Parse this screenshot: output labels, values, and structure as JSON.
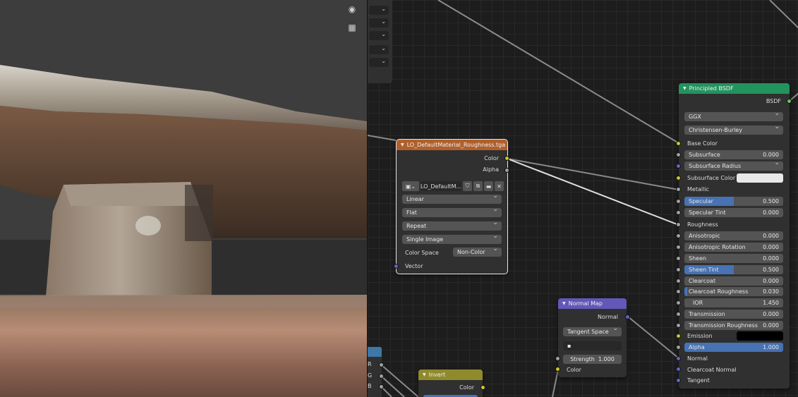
{
  "viewport": {
    "camera_icon": "camera-icon",
    "grid_icon": "grid-perspective-icon"
  },
  "texture_node": {
    "title": "LO_DefaultMaterial_Roughness.tga",
    "outputs": [
      "Color",
      "Alpha"
    ],
    "image_name": "LO_DefaultM...",
    "interpolation": "Linear",
    "projection": "Flat",
    "extension": "Repeat",
    "source": "Single Image",
    "color_space_label": "Color Space",
    "color_space_value": "Non-Color",
    "input_vector": "Vector",
    "header_color": "#b0602c"
  },
  "normal_map_node": {
    "title": "Normal Map",
    "output": "Normal",
    "space": "Tangent Space",
    "uv_map": "",
    "strength_label": "Strength",
    "strength_value": "1.000",
    "input_color": "Color",
    "header_color": "#6357b7"
  },
  "invert_node": {
    "title": "Invert",
    "output": "Color",
    "header_color": "#8f8a2b"
  },
  "partial_node": {
    "labels": [
      "R",
      "G",
      "B"
    ]
  },
  "bsdf_node": {
    "title": "Principled BSDF",
    "output": "BSDF",
    "distribution": "GGX",
    "subsurface_method": "Christensen-Burley",
    "header_color": "#23935d",
    "base_color_label": "Base Color",
    "subsurface": {
      "label": "Subsurface",
      "value": "0.000"
    },
    "subsurface_radius": "Subsurface Radius",
    "subsurface_color_label": "Subsurface Color",
    "metallic_label": "Metallic",
    "specular": {
      "label": "Specular",
      "value": "0.500",
      "fill": 0.5
    },
    "specular_tint": {
      "label": "Specular Tint",
      "value": "0.000"
    },
    "roughness_label": "Roughness",
    "anisotropic": {
      "label": "Anisotropic",
      "value": "0.000"
    },
    "anisotropic_rotation": {
      "label": "Anisotropic Rotation",
      "value": "0.000"
    },
    "sheen": {
      "label": "Sheen",
      "value": "0.000"
    },
    "sheen_tint": {
      "label": "Sheen Tint",
      "value": "0.500",
      "fill": 0.5
    },
    "clearcoat": {
      "label": "Clearcoat",
      "value": "0.000"
    },
    "clearcoat_roughness": {
      "label": "Clearcoat Roughness",
      "value": "0.030",
      "fill": 0.03
    },
    "ior": {
      "label": "IOR",
      "value": "1.450"
    },
    "transmission": {
      "label": "Transmission",
      "value": "0.000"
    },
    "transmission_roughness": {
      "label": "Transmission Roughness",
      "value": "0.000"
    },
    "emission_label": "Emission",
    "alpha": {
      "label": "Alpha",
      "value": "1.000",
      "fill": 1.0
    },
    "normal_label": "Normal",
    "clearcoat_normal_label": "Clearcoat Normal",
    "tangent_label": "Tangent"
  }
}
